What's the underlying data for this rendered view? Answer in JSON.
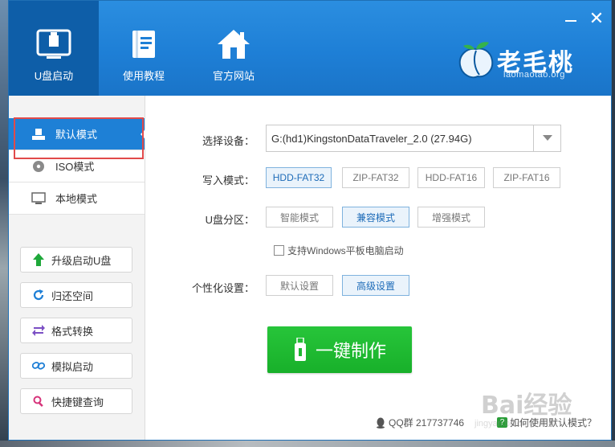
{
  "window": {
    "close_glyph": "✕"
  },
  "nav": {
    "tabs": [
      {
        "label": "U盘启动",
        "icon": "usb-drive-icon",
        "active": true
      },
      {
        "label": "使用教程",
        "icon": "book-icon",
        "active": false
      },
      {
        "label": "官方网站",
        "icon": "home-icon",
        "active": false
      }
    ]
  },
  "logo": {
    "name": "老毛桃",
    "url": "laomaotao.org"
  },
  "sidebar": {
    "modes": [
      {
        "label": "默认模式",
        "icon": "usb-monitor-icon",
        "active": true
      },
      {
        "label": "ISO模式",
        "icon": "disc-icon",
        "active": false
      },
      {
        "label": "本地模式",
        "icon": "monitor-icon",
        "active": false
      }
    ],
    "tools": [
      {
        "label": "升级启动U盘",
        "icon": "arrow-up-icon"
      },
      {
        "label": "归还空间",
        "icon": "refresh-icon"
      },
      {
        "label": "格式转换",
        "icon": "swap-icon"
      },
      {
        "label": "模拟启动",
        "icon": "link-icon"
      },
      {
        "label": "快捷键查询",
        "icon": "search-icon"
      }
    ]
  },
  "form": {
    "device_label": "选择设备：",
    "device_value": "G:(hd1)KingstonDataTraveler_2.0 (27.94G)",
    "write_mode_label": "写入模式：",
    "write_modes": [
      "HDD-FAT32",
      "ZIP-FAT32",
      "HDD-FAT16",
      "ZIP-FAT16"
    ],
    "write_mode_selected": "HDD-FAT32",
    "partition_label": "U盘分区：",
    "partitions": [
      "智能模式",
      "兼容模式",
      "增强模式"
    ],
    "partition_selected": "兼容模式",
    "checkbox_label": "支持Windows平板电脑启动",
    "checkbox_checked": false,
    "personalize_label": "个性化设置：",
    "personalize_options": [
      "默认设置",
      "高级设置"
    ],
    "personalize_selected": "高级设置",
    "make_button": "一键制作"
  },
  "footer": {
    "qq_text": "QQ群 217737746",
    "help_text": "如何使用默认模式？"
  },
  "watermark": {
    "text": "Bai经验",
    "sub": "jingyan.baidu.com"
  },
  "colors": {
    "header_blue": "#1e7fd6",
    "active_tab": "#0e5ea8",
    "accent_green": "#1fb833",
    "highlight_red": "#e14a4a"
  }
}
